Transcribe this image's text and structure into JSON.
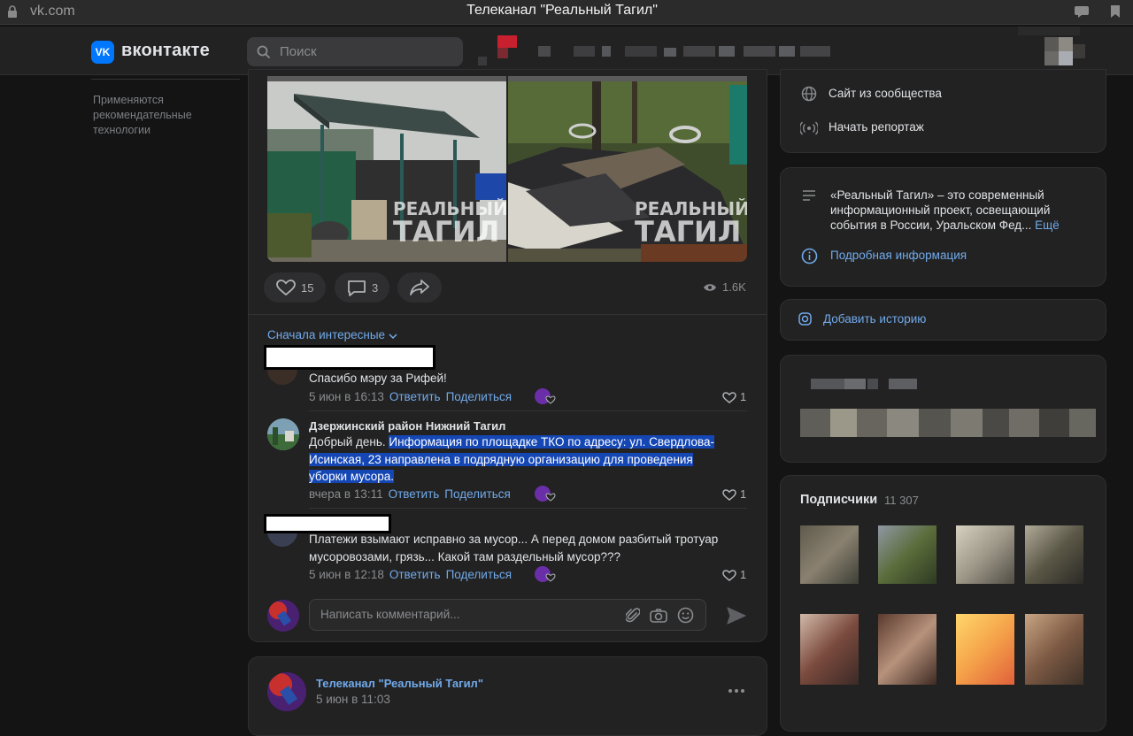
{
  "browser": {
    "url": "vk.com",
    "window_title": "Телеканал \"Реальный Тагил\""
  },
  "header": {
    "logo_mark": "VK",
    "logo_text": "вконтакте",
    "search_placeholder": "Поиск",
    "accent": "#0077ff"
  },
  "left": {
    "note": "Применяются рекомендательные технологии"
  },
  "post": {
    "watermark_line1": "РЕАЛЬНЫЙ",
    "watermark_line2": "ТАГИЛ",
    "likes": "15",
    "comments": "3",
    "views": "1.6K"
  },
  "comments": {
    "sort_label": "Сначала интересные",
    "reply_label": "Ответить",
    "share_label": "Поделиться",
    "items": [
      {
        "text": "Спасибо мэру за Рифей!",
        "time": "5 июн в 16:13",
        "likes": "1"
      },
      {
        "author": "Дзержинский район Нижний Тагил",
        "text_plain": "Добрый день. ",
        "text_highlight_1": "Информация по площадке ТКО по адресу: ул. Свердлова-",
        "text_highlight_2": "Исинская, 23 направлена в подрядную организацию для проведения",
        "text_highlight_3": "уборки мусора.",
        "time": "вчера в 13:11",
        "likes": "1"
      },
      {
        "text_1": "Платежи взымают исправно за мусор... А перед домом разбитый тротуар",
        "text_2": "мусоровозами, грязь... Какой там раздельный мусор???",
        "time": "5 июн в 12:18",
        "likes": "1"
      }
    ],
    "composer_placeholder": "Написать комментарий..."
  },
  "next_post": {
    "author": "Телеканал \"Реальный Тагил\"",
    "time": "5 июн в 11:03"
  },
  "right": {
    "site_link": "Сайт из сообщества",
    "report_link": "Начать репортаж",
    "about_1": "«Реальный Тагил» – это современный",
    "about_2": "информационный проект, освещающий",
    "about_3": "события в России, Уральском Фед...",
    "about_more": "Ещё",
    "details_link": "Подробная информация",
    "add_story": "Добавить историю",
    "subscribers_title": "Подписчики",
    "subscribers_count": "11 307"
  }
}
